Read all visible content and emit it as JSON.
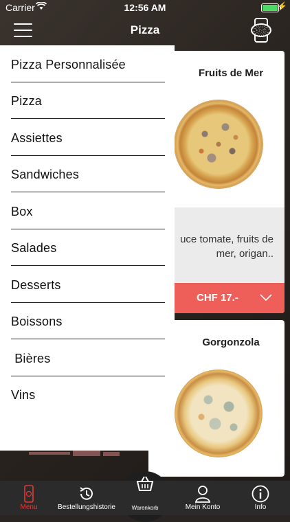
{
  "status_bar": {
    "carrier": "Carrier",
    "time": "12:56 AM"
  },
  "header": {
    "title": "Pizza"
  },
  "menu": {
    "items": [
      {
        "label": "Pizza Personnalisée"
      },
      {
        "label": "Pizza"
      },
      {
        "label": "Assiettes"
      },
      {
        "label": "Sandwiches"
      },
      {
        "label": "Box"
      },
      {
        "label": "Salades"
      },
      {
        "label": "Desserts"
      },
      {
        "label": "Boissons"
      },
      {
        "label": " Bières"
      },
      {
        "label": "Vins"
      }
    ]
  },
  "products": [
    {
      "name": "Fruits de Mer",
      "description_line1": "uce tomate, fruits de",
      "description_line2": "mer, origan..",
      "price": "CHF 17.-"
    },
    {
      "name": "Gorgonzola"
    }
  ],
  "tabbar": {
    "menu": "Menu",
    "history": "Bestellungshistorie",
    "cart": "Warenkorb",
    "account": "Mein Konto",
    "info": "Info"
  },
  "colors": {
    "accent": "#ef5f5a",
    "active_tab": "#e53935",
    "tabbar_bg": "#2b2b2b"
  }
}
